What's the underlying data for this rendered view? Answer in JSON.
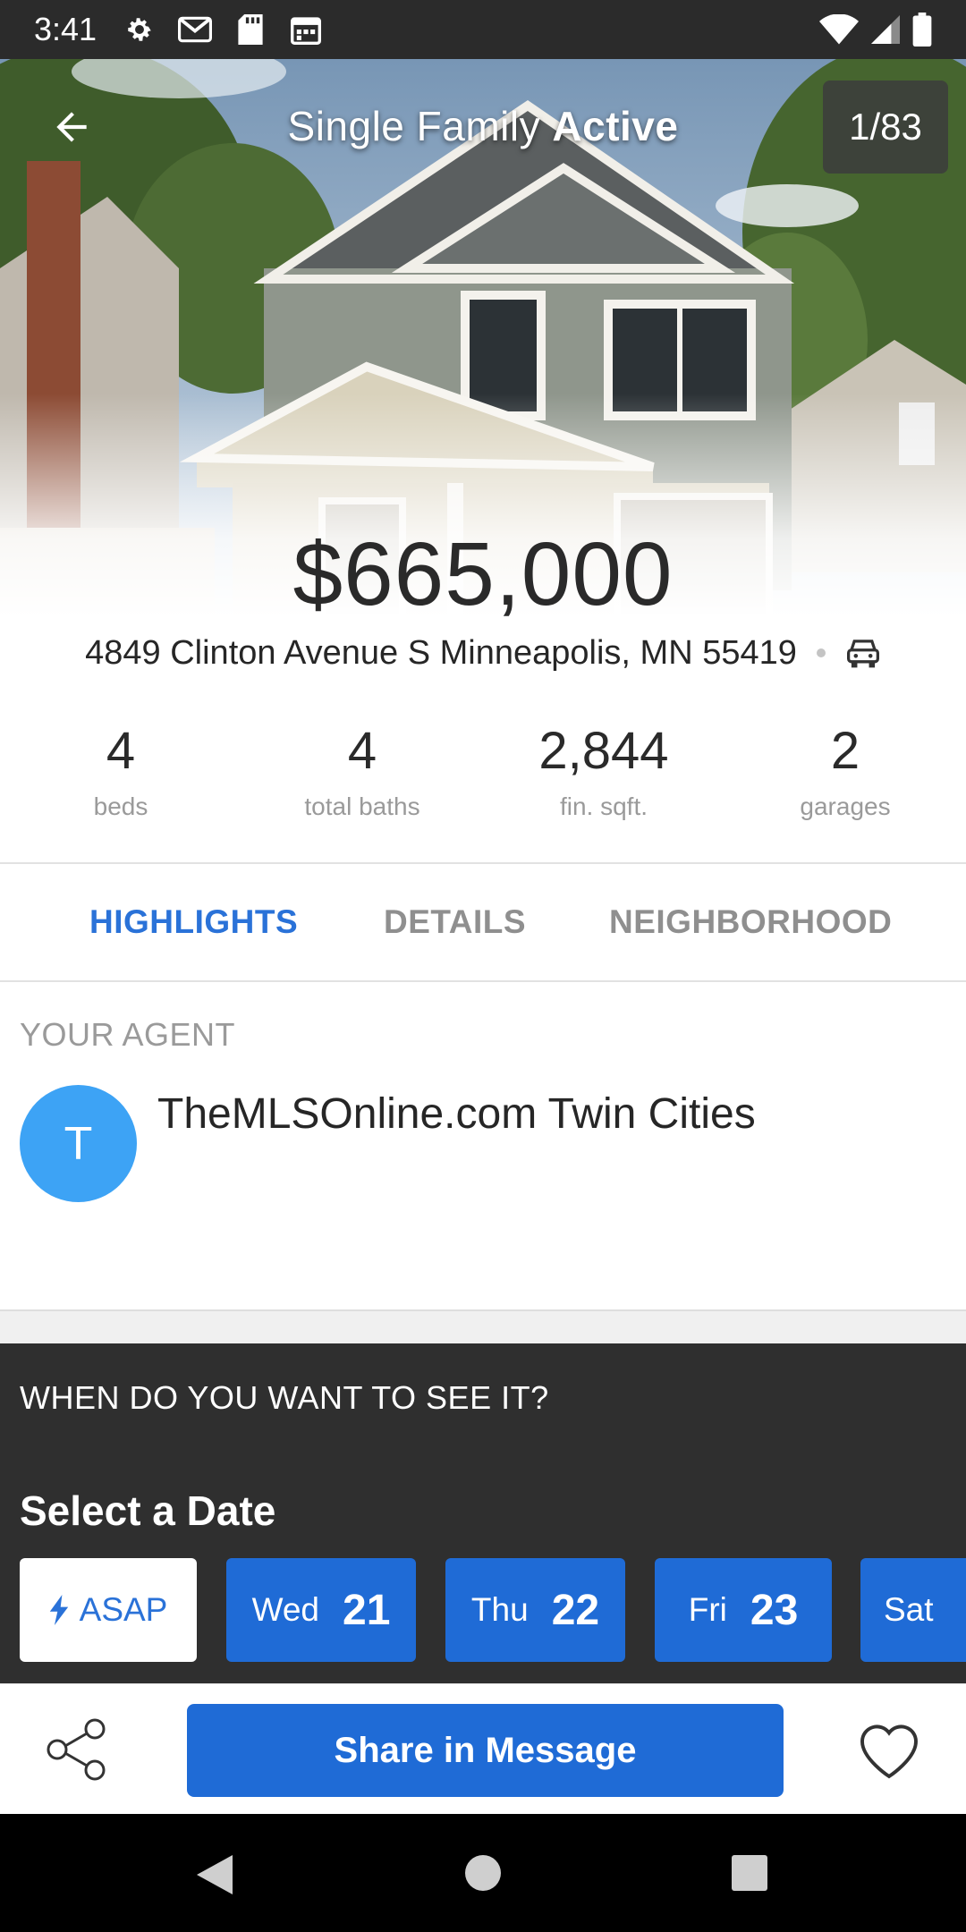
{
  "status_bar": {
    "time": "3:41",
    "left_icons": [
      "settings-icon",
      "gmail-icon",
      "sd-card-icon",
      "calendar-icon"
    ],
    "right_icons": [
      "wifi-icon",
      "signal-icon",
      "battery-icon"
    ]
  },
  "header": {
    "title_type": "Single Family",
    "title_status": "Active",
    "photo_counter": "1/83"
  },
  "listing": {
    "price": "$665,000",
    "address": "4849 Clinton Avenue S Minneapolis, MN 55419"
  },
  "stats": [
    {
      "value": "4",
      "label": "beds"
    },
    {
      "value": "4",
      "label": "total baths"
    },
    {
      "value": "2,844",
      "label": "fin. sqft."
    },
    {
      "value": "2",
      "label": "garages"
    }
  ],
  "tabs": [
    {
      "label": "HIGHLIGHTS",
      "active": true
    },
    {
      "label": "DETAILS",
      "active": false
    },
    {
      "label": "NEIGHBORHOOD",
      "active": false
    }
  ],
  "agent": {
    "heading": "YOUR AGENT",
    "initial": "T",
    "name": "TheMLSOnline.com Twin Cities"
  },
  "schedule": {
    "question": "WHEN DO YOU WANT TO SEE IT?",
    "title": "Select a Date",
    "asap_label": "ASAP",
    "dates": [
      {
        "day": "Wed",
        "num": "21"
      },
      {
        "day": "Thu",
        "num": "22"
      },
      {
        "day": "Fri",
        "num": "23"
      },
      {
        "day": "Sat",
        "num": ""
      }
    ]
  },
  "actions": {
    "share_message_label": "Share in Message"
  },
  "colors": {
    "accent_blue": "#1f6bd6",
    "tab_active": "#2a72d8",
    "avatar_blue": "#3da3f5",
    "schedule_bg": "#2f2f2f"
  }
}
